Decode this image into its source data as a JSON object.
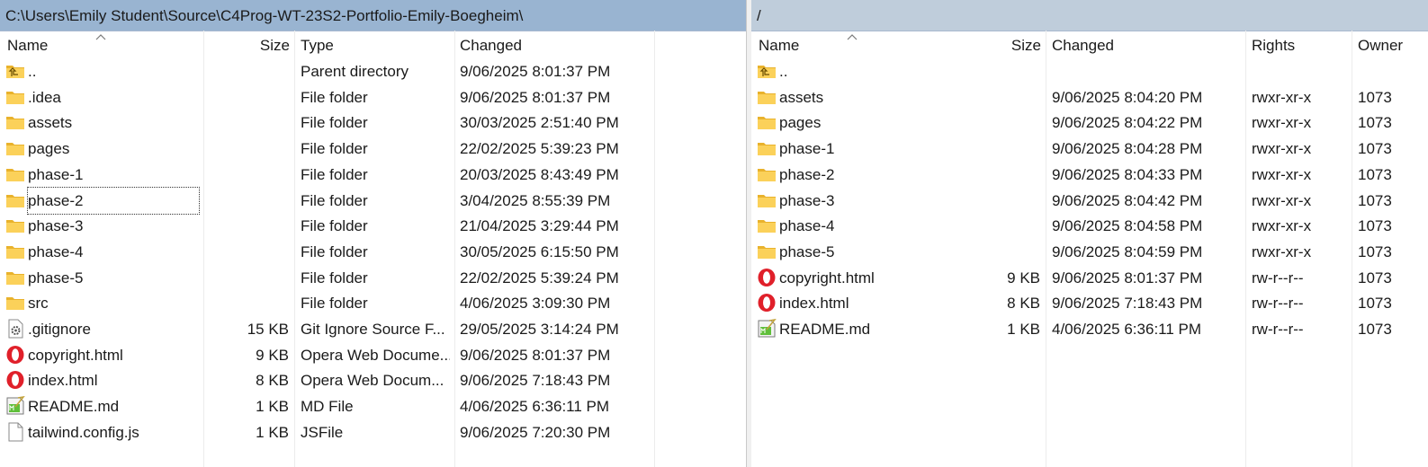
{
  "left": {
    "path": "C:\\Users\\Emily Student\\Source\\C4Prog-WT-23S2-Portfolio-Emily-Boegheim\\",
    "columns": [
      "Name",
      "Size",
      "Type",
      "Changed"
    ],
    "rows": [
      {
        "icon": "parent-directory-icon",
        "name": "..",
        "size": "",
        "type": "Parent directory",
        "changed": "9/06/2025 8:01:37 PM"
      },
      {
        "icon": "folder-icon",
        "name": ".idea",
        "size": "",
        "type": "File folder",
        "changed": "9/06/2025 8:01:37 PM"
      },
      {
        "icon": "folder-icon",
        "name": "assets",
        "size": "",
        "type": "File folder",
        "changed": "30/03/2025 2:51:40 PM"
      },
      {
        "icon": "folder-icon",
        "name": "pages",
        "size": "",
        "type": "File folder",
        "changed": "22/02/2025 5:39:23 PM"
      },
      {
        "icon": "folder-icon",
        "name": "phase-1",
        "size": "",
        "type": "File folder",
        "changed": "20/03/2025 8:43:49 PM"
      },
      {
        "icon": "folder-icon",
        "name": "phase-2",
        "size": "",
        "type": "File folder",
        "changed": "3/04/2025 8:55:39 PM"
      },
      {
        "icon": "folder-icon",
        "name": "phase-3",
        "size": "",
        "type": "File folder",
        "changed": "21/04/2025 3:29:44 PM"
      },
      {
        "icon": "folder-icon",
        "name": "phase-4",
        "size": "",
        "type": "File folder",
        "changed": "30/05/2025 6:15:50 PM"
      },
      {
        "icon": "folder-icon",
        "name": "phase-5",
        "size": "",
        "type": "File folder",
        "changed": "22/02/2025 5:39:24 PM"
      },
      {
        "icon": "folder-icon",
        "name": "src",
        "size": "",
        "type": "File folder",
        "changed": "4/06/2025 3:09:30 PM"
      },
      {
        "icon": "gear-file-icon",
        "name": ".gitignore",
        "size": "15 KB",
        "type": "Git Ignore Source F...",
        "changed": "29/05/2025 3:14:24 PM"
      },
      {
        "icon": "opera-icon",
        "name": "copyright.html",
        "size": "9 KB",
        "type": "Opera Web Docume...",
        "changed": "9/06/2025 8:01:37 PM"
      },
      {
        "icon": "opera-icon",
        "name": "index.html",
        "size": "8 KB",
        "type": "Opera Web Docum...",
        "changed": "9/06/2025 7:18:43 PM"
      },
      {
        "icon": "markdown-file-icon",
        "name": "README.md",
        "size": "1 KB",
        "type": "MD File",
        "changed": "4/06/2025 6:36:11 PM"
      },
      {
        "icon": "blank-file-icon",
        "name": "tailwind.config.js",
        "size": "1 KB",
        "type": "JSFile",
        "changed": "9/06/2025 7:20:30 PM"
      }
    ]
  },
  "right": {
    "path": "/",
    "columns": [
      "Name",
      "Size",
      "Changed",
      "Rights",
      "Owner"
    ],
    "rows": [
      {
        "icon": "parent-directory-icon",
        "name": "..",
        "size": "",
        "changed": "",
        "rights": "",
        "owner": ""
      },
      {
        "icon": "folder-icon",
        "name": "assets",
        "size": "",
        "changed": "9/06/2025 8:04:20 PM",
        "rights": "rwxr-xr-x",
        "owner": "1073"
      },
      {
        "icon": "folder-icon",
        "name": "pages",
        "size": "",
        "changed": "9/06/2025 8:04:22 PM",
        "rights": "rwxr-xr-x",
        "owner": "1073"
      },
      {
        "icon": "folder-icon",
        "name": "phase-1",
        "size": "",
        "changed": "9/06/2025 8:04:28 PM",
        "rights": "rwxr-xr-x",
        "owner": "1073"
      },
      {
        "icon": "folder-icon",
        "name": "phase-2",
        "size": "",
        "changed": "9/06/2025 8:04:33 PM",
        "rights": "rwxr-xr-x",
        "owner": "1073"
      },
      {
        "icon": "folder-icon",
        "name": "phase-3",
        "size": "",
        "changed": "9/06/2025 8:04:42 PM",
        "rights": "rwxr-xr-x",
        "owner": "1073"
      },
      {
        "icon": "folder-icon",
        "name": "phase-4",
        "size": "",
        "changed": "9/06/2025 8:04:58 PM",
        "rights": "rwxr-xr-x",
        "owner": "1073"
      },
      {
        "icon": "folder-icon",
        "name": "phase-5",
        "size": "",
        "changed": "9/06/2025 8:04:59 PM",
        "rights": "rwxr-xr-x",
        "owner": "1073"
      },
      {
        "icon": "opera-icon",
        "name": "copyright.html",
        "size": "9 KB",
        "changed": "9/06/2025 8:01:37 PM",
        "rights": "rw-r--r--",
        "owner": "1073"
      },
      {
        "icon": "opera-icon",
        "name": "index.html",
        "size": "8 KB",
        "changed": "9/06/2025 7:18:43 PM",
        "rights": "rw-r--r--",
        "owner": "1073"
      },
      {
        "icon": "markdown-file-icon",
        "name": "README.md",
        "size": "1 KB",
        "changed": "4/06/2025 6:36:11 PM",
        "rights": "rw-r--r--",
        "owner": "1073"
      }
    ]
  },
  "colors": {
    "active_path_bar": "#99b4d1",
    "inactive_path_bar": "#bfcddb",
    "folder": "#f8c53a",
    "opera_red": "#e0202a"
  }
}
